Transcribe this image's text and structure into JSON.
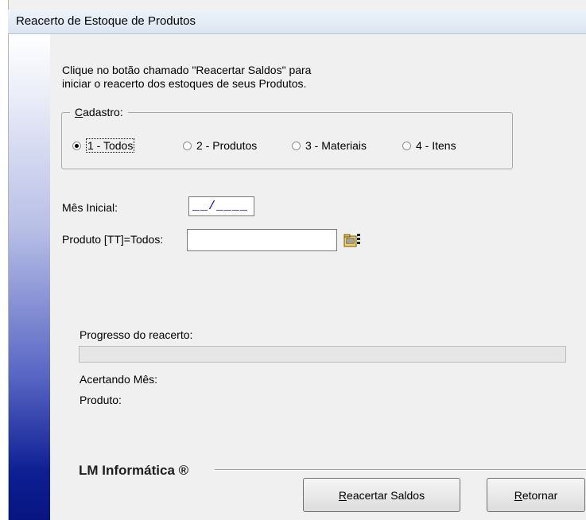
{
  "window": {
    "title": "Reacerto de Estoque de Produtos"
  },
  "intro": {
    "line1": "Clique no botão chamado \"Reacertar Saldos\" para",
    "line2": "iniciar o reacerto dos estoques de seus Produtos."
  },
  "cadastro": {
    "legend_mnemonic": "C",
    "legend_rest": "adastro:",
    "options": [
      {
        "label": "1 - Todos",
        "selected": true
      },
      {
        "label": "2 - Produtos",
        "selected": false
      },
      {
        "label": "3 - Materiais",
        "selected": false
      },
      {
        "label": "4 - Itens",
        "selected": false
      }
    ]
  },
  "fields": {
    "mes_label": "Mês Inicial:",
    "mes_value": "__/____",
    "produto_label": "Produto [TT]=Todos:",
    "produto_value": ""
  },
  "icons": {
    "lookup": "folder-search-icon"
  },
  "progress": {
    "label": "Progresso do reacerto:",
    "value": 0,
    "acertando_label": "Acertando Mês:",
    "produto_label": "Produto:"
  },
  "brand": {
    "text": "LM Informática ®"
  },
  "buttons": {
    "reacertar_mnemonic": "R",
    "reacertar_rest": "eacertar Saldos",
    "retornar_mnemonic": "R",
    "retornar_rest": "etornar"
  },
  "colors": {
    "gradient_bottom": "#081580",
    "mask_text": "#0000c8"
  }
}
